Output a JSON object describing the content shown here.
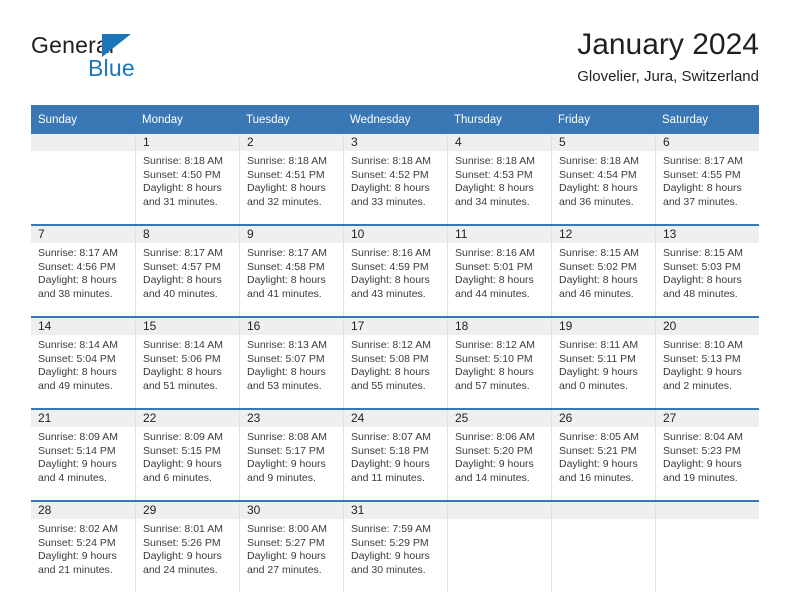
{
  "brand": {
    "name_top": "General",
    "name_bottom": "Blue",
    "accent_color": "#1b76bc"
  },
  "header": {
    "title": "January 2024",
    "subtitle": "Glovelier, Jura, Switzerland"
  },
  "calendar": {
    "header_bg": "#3a78b5",
    "daynum_bg": "#efefef",
    "weekday_names": [
      "Sunday",
      "Monday",
      "Tuesday",
      "Wednesday",
      "Thursday",
      "Friday",
      "Saturday"
    ],
    "weeks": [
      [
        {
          "day": "",
          "sunrise": "",
          "sunset": "",
          "daylight_line1": "",
          "daylight_line2": ""
        },
        {
          "day": "1",
          "sunrise": "Sunrise: 8:18 AM",
          "sunset": "Sunset: 4:50 PM",
          "daylight_line1": "Daylight: 8 hours",
          "daylight_line2": "and 31 minutes."
        },
        {
          "day": "2",
          "sunrise": "Sunrise: 8:18 AM",
          "sunset": "Sunset: 4:51 PM",
          "daylight_line1": "Daylight: 8 hours",
          "daylight_line2": "and 32 minutes."
        },
        {
          "day": "3",
          "sunrise": "Sunrise: 8:18 AM",
          "sunset": "Sunset: 4:52 PM",
          "daylight_line1": "Daylight: 8 hours",
          "daylight_line2": "and 33 minutes."
        },
        {
          "day": "4",
          "sunrise": "Sunrise: 8:18 AM",
          "sunset": "Sunset: 4:53 PM",
          "daylight_line1": "Daylight: 8 hours",
          "daylight_line2": "and 34 minutes."
        },
        {
          "day": "5",
          "sunrise": "Sunrise: 8:18 AM",
          "sunset": "Sunset: 4:54 PM",
          "daylight_line1": "Daylight: 8 hours",
          "daylight_line2": "and 36 minutes."
        },
        {
          "day": "6",
          "sunrise": "Sunrise: 8:17 AM",
          "sunset": "Sunset: 4:55 PM",
          "daylight_line1": "Daylight: 8 hours",
          "daylight_line2": "and 37 minutes."
        }
      ],
      [
        {
          "day": "7",
          "sunrise": "Sunrise: 8:17 AM",
          "sunset": "Sunset: 4:56 PM",
          "daylight_line1": "Daylight: 8 hours",
          "daylight_line2": "and 38 minutes."
        },
        {
          "day": "8",
          "sunrise": "Sunrise: 8:17 AM",
          "sunset": "Sunset: 4:57 PM",
          "daylight_line1": "Daylight: 8 hours",
          "daylight_line2": "and 40 minutes."
        },
        {
          "day": "9",
          "sunrise": "Sunrise: 8:17 AM",
          "sunset": "Sunset: 4:58 PM",
          "daylight_line1": "Daylight: 8 hours",
          "daylight_line2": "and 41 minutes."
        },
        {
          "day": "10",
          "sunrise": "Sunrise: 8:16 AM",
          "sunset": "Sunset: 4:59 PM",
          "daylight_line1": "Daylight: 8 hours",
          "daylight_line2": "and 43 minutes."
        },
        {
          "day": "11",
          "sunrise": "Sunrise: 8:16 AM",
          "sunset": "Sunset: 5:01 PM",
          "daylight_line1": "Daylight: 8 hours",
          "daylight_line2": "and 44 minutes."
        },
        {
          "day": "12",
          "sunrise": "Sunrise: 8:15 AM",
          "sunset": "Sunset: 5:02 PM",
          "daylight_line1": "Daylight: 8 hours",
          "daylight_line2": "and 46 minutes."
        },
        {
          "day": "13",
          "sunrise": "Sunrise: 8:15 AM",
          "sunset": "Sunset: 5:03 PM",
          "daylight_line1": "Daylight: 8 hours",
          "daylight_line2": "and 48 minutes."
        }
      ],
      [
        {
          "day": "14",
          "sunrise": "Sunrise: 8:14 AM",
          "sunset": "Sunset: 5:04 PM",
          "daylight_line1": "Daylight: 8 hours",
          "daylight_line2": "and 49 minutes."
        },
        {
          "day": "15",
          "sunrise": "Sunrise: 8:14 AM",
          "sunset": "Sunset: 5:06 PM",
          "daylight_line1": "Daylight: 8 hours",
          "daylight_line2": "and 51 minutes."
        },
        {
          "day": "16",
          "sunrise": "Sunrise: 8:13 AM",
          "sunset": "Sunset: 5:07 PM",
          "daylight_line1": "Daylight: 8 hours",
          "daylight_line2": "and 53 minutes."
        },
        {
          "day": "17",
          "sunrise": "Sunrise: 8:12 AM",
          "sunset": "Sunset: 5:08 PM",
          "daylight_line1": "Daylight: 8 hours",
          "daylight_line2": "and 55 minutes."
        },
        {
          "day": "18",
          "sunrise": "Sunrise: 8:12 AM",
          "sunset": "Sunset: 5:10 PM",
          "daylight_line1": "Daylight: 8 hours",
          "daylight_line2": "and 57 minutes."
        },
        {
          "day": "19",
          "sunrise": "Sunrise: 8:11 AM",
          "sunset": "Sunset: 5:11 PM",
          "daylight_line1": "Daylight: 9 hours",
          "daylight_line2": "and 0 minutes."
        },
        {
          "day": "20",
          "sunrise": "Sunrise: 8:10 AM",
          "sunset": "Sunset: 5:13 PM",
          "daylight_line1": "Daylight: 9 hours",
          "daylight_line2": "and 2 minutes."
        }
      ],
      [
        {
          "day": "21",
          "sunrise": "Sunrise: 8:09 AM",
          "sunset": "Sunset: 5:14 PM",
          "daylight_line1": "Daylight: 9 hours",
          "daylight_line2": "and 4 minutes."
        },
        {
          "day": "22",
          "sunrise": "Sunrise: 8:09 AM",
          "sunset": "Sunset: 5:15 PM",
          "daylight_line1": "Daylight: 9 hours",
          "daylight_line2": "and 6 minutes."
        },
        {
          "day": "23",
          "sunrise": "Sunrise: 8:08 AM",
          "sunset": "Sunset: 5:17 PM",
          "daylight_line1": "Daylight: 9 hours",
          "daylight_line2": "and 9 minutes."
        },
        {
          "day": "24",
          "sunrise": "Sunrise: 8:07 AM",
          "sunset": "Sunset: 5:18 PM",
          "daylight_line1": "Daylight: 9 hours",
          "daylight_line2": "and 11 minutes."
        },
        {
          "day": "25",
          "sunrise": "Sunrise: 8:06 AM",
          "sunset": "Sunset: 5:20 PM",
          "daylight_line1": "Daylight: 9 hours",
          "daylight_line2": "and 14 minutes."
        },
        {
          "day": "26",
          "sunrise": "Sunrise: 8:05 AM",
          "sunset": "Sunset: 5:21 PM",
          "daylight_line1": "Daylight: 9 hours",
          "daylight_line2": "and 16 minutes."
        },
        {
          "day": "27",
          "sunrise": "Sunrise: 8:04 AM",
          "sunset": "Sunset: 5:23 PM",
          "daylight_line1": "Daylight: 9 hours",
          "daylight_line2": "and 19 minutes."
        }
      ],
      [
        {
          "day": "28",
          "sunrise": "Sunrise: 8:02 AM",
          "sunset": "Sunset: 5:24 PM",
          "daylight_line1": "Daylight: 9 hours",
          "daylight_line2": "and 21 minutes."
        },
        {
          "day": "29",
          "sunrise": "Sunrise: 8:01 AM",
          "sunset": "Sunset: 5:26 PM",
          "daylight_line1": "Daylight: 9 hours",
          "daylight_line2": "and 24 minutes."
        },
        {
          "day": "30",
          "sunrise": "Sunrise: 8:00 AM",
          "sunset": "Sunset: 5:27 PM",
          "daylight_line1": "Daylight: 9 hours",
          "daylight_line2": "and 27 minutes."
        },
        {
          "day": "31",
          "sunrise": "Sunrise: 7:59 AM",
          "sunset": "Sunset: 5:29 PM",
          "daylight_line1": "Daylight: 9 hours",
          "daylight_line2": "and 30 minutes."
        },
        {
          "day": "",
          "sunrise": "",
          "sunset": "",
          "daylight_line1": "",
          "daylight_line2": ""
        },
        {
          "day": "",
          "sunrise": "",
          "sunset": "",
          "daylight_line1": "",
          "daylight_line2": ""
        },
        {
          "day": "",
          "sunrise": "",
          "sunset": "",
          "daylight_line1": "",
          "daylight_line2": ""
        }
      ]
    ]
  }
}
